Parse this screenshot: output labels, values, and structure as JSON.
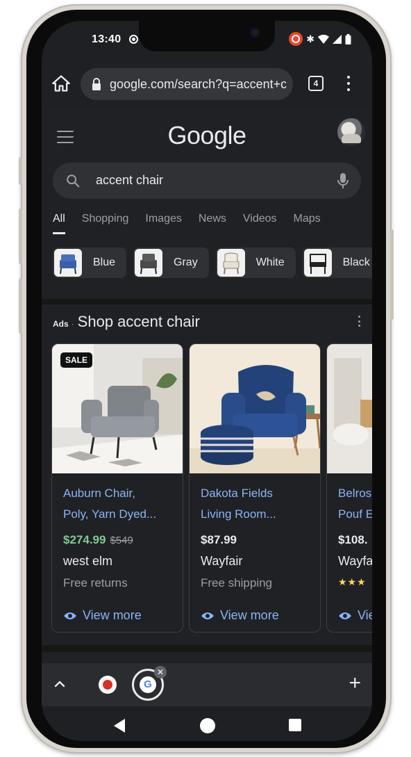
{
  "status_bar": {
    "time": "13:40",
    "icons": [
      "screen-record-icon",
      "bluetooth-icon",
      "wifi-icon",
      "signal-icon",
      "battery-icon"
    ]
  },
  "browser": {
    "url": "google.com/search?q=accent+chair",
    "tab_count": "4"
  },
  "google": {
    "logo": "Google",
    "search_query": "accent chair",
    "tabs": [
      {
        "label": "All",
        "active": true
      },
      {
        "label": "Shopping"
      },
      {
        "label": "Images"
      },
      {
        "label": "News"
      },
      {
        "label": "Videos"
      },
      {
        "label": "Maps"
      }
    ],
    "chips": [
      {
        "label": "Blue"
      },
      {
        "label": "Gray"
      },
      {
        "label": "White"
      },
      {
        "label": "Black"
      }
    ]
  },
  "ads": {
    "tag": "Ads",
    "separator": "·",
    "title": "Shop accent chair",
    "products": [
      {
        "badge": "SALE",
        "title_line1": "Auburn Chair,",
        "title_line2": "Poly, Yarn Dyed...",
        "price": "$274.99",
        "old_price": "$549",
        "store": "west elm",
        "extra": "Free returns",
        "view_more": "View more"
      },
      {
        "title_line1": "Dakota Fields",
        "title_line2": "Living Room...",
        "price": "$87.99",
        "store": "Wayfair",
        "extra": "Free shipping",
        "view_more": "View more"
      },
      {
        "title_line1": "Belrose",
        "title_line2": "Pouf E",
        "price": "$108.",
        "store": "Wayfair",
        "stars": "★★★",
        "view_more": "View more"
      }
    ]
  },
  "colors": {
    "link": "#8ab4f8",
    "sale_price": "#81c995",
    "background": "#202124"
  }
}
